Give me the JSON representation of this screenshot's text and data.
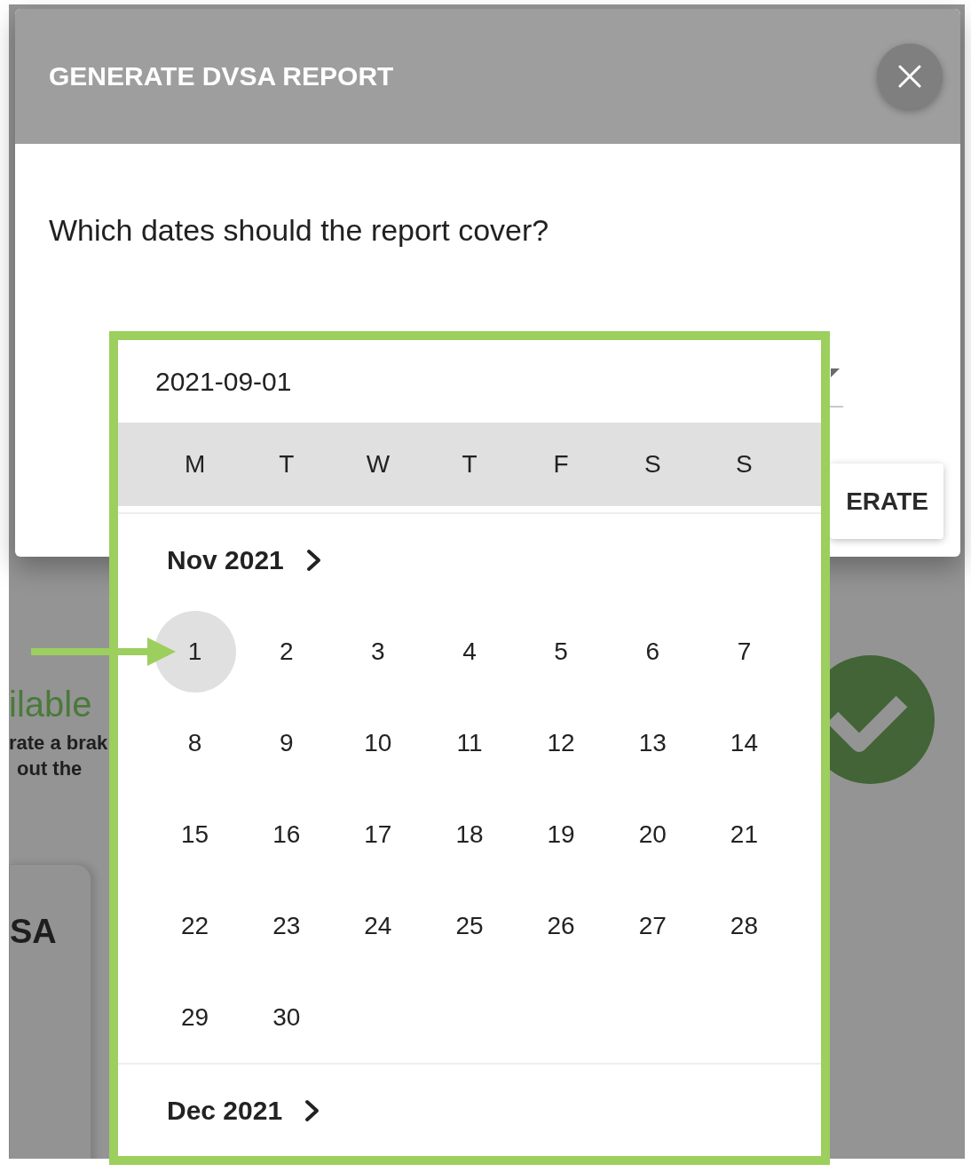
{
  "background_page": {
    "status_text": "ilable",
    "description_lines": [
      "rate a brak",
      "out the"
    ],
    "card_title": "SA"
  },
  "dialog": {
    "title": "GENERATE DVSA REPORT",
    "question": "Which dates should the report cover?",
    "generate_button": "ERATE"
  },
  "date_picker": {
    "value": "2021-09-01",
    "weekdays": [
      "M",
      "T",
      "W",
      "T",
      "F",
      "S",
      "S"
    ],
    "months": [
      {
        "title": "Nov 2021",
        "weeks": [
          [
            {
              "label": "1",
              "selected": true
            },
            {
              "label": "2",
              "selected": false
            },
            {
              "label": "3",
              "selected": false
            },
            {
              "label": "4",
              "selected": false
            },
            {
              "label": "5",
              "selected": false
            },
            {
              "label": "6",
              "selected": false
            },
            {
              "label": "7",
              "selected": false
            }
          ],
          [
            {
              "label": "8",
              "selected": false
            },
            {
              "label": "9",
              "selected": false
            },
            {
              "label": "10",
              "selected": false
            },
            {
              "label": "11",
              "selected": false
            },
            {
              "label": "12",
              "selected": false
            },
            {
              "label": "13",
              "selected": false
            },
            {
              "label": "14",
              "selected": false
            }
          ],
          [
            {
              "label": "15",
              "selected": false
            },
            {
              "label": "16",
              "selected": false
            },
            {
              "label": "17",
              "selected": false
            },
            {
              "label": "18",
              "selected": false
            },
            {
              "label": "19",
              "selected": false
            },
            {
              "label": "20",
              "selected": false
            },
            {
              "label": "21",
              "selected": false
            }
          ],
          [
            {
              "label": "22",
              "selected": false
            },
            {
              "label": "23",
              "selected": false
            },
            {
              "label": "24",
              "selected": false
            },
            {
              "label": "25",
              "selected": false
            },
            {
              "label": "26",
              "selected": false
            },
            {
              "label": "27",
              "selected": false
            },
            {
              "label": "28",
              "selected": false
            }
          ],
          [
            {
              "label": "29",
              "selected": false
            },
            {
              "label": "30",
              "selected": false
            }
          ]
        ]
      },
      {
        "title": "Dec 2021"
      }
    ]
  }
}
